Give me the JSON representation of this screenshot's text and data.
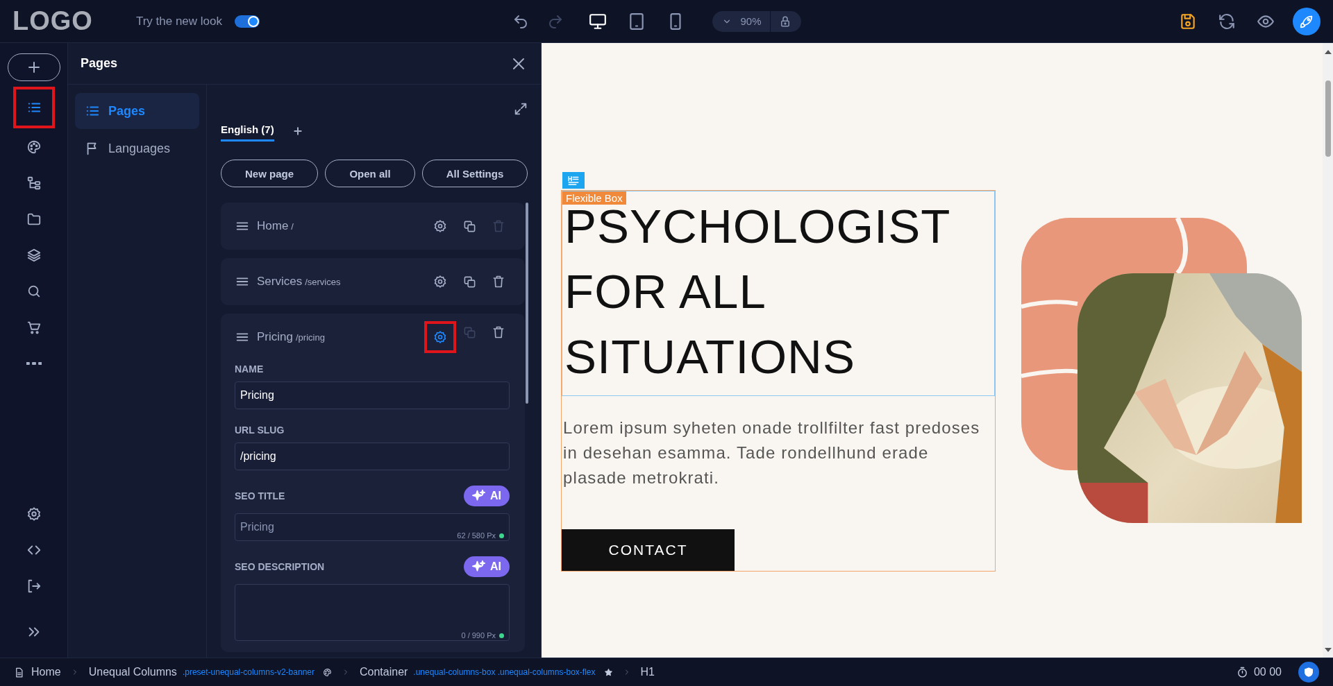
{
  "topbar": {
    "logo": "LOGO",
    "new_look": {
      "label": "Try the new look",
      "on": true
    },
    "history": [
      {
        "kind": "undo",
        "disabled": false
      },
      {
        "kind": "redo",
        "disabled": true
      }
    ],
    "devices": [
      {
        "kind": "desktop",
        "selected": true
      },
      {
        "kind": "tablet",
        "selected": false
      },
      {
        "kind": "phone",
        "selected": false
      }
    ],
    "zoom": "90%"
  },
  "rail": {
    "items": [
      {
        "kind": "add",
        "selected": false,
        "highlighted": false
      },
      {
        "kind": "list",
        "selected": true,
        "highlighted": true
      },
      {
        "kind": "palette",
        "selected": false,
        "highlighted": false
      },
      {
        "kind": "tree",
        "selected": false,
        "highlighted": false
      },
      {
        "kind": "folder",
        "selected": false,
        "highlighted": false
      },
      {
        "kind": "layers",
        "selected": false,
        "highlighted": false
      },
      {
        "kind": "search",
        "selected": false,
        "highlighted": false
      },
      {
        "kind": "cart",
        "selected": false,
        "highlighted": false
      },
      {
        "kind": "more",
        "selected": false,
        "highlighted": false
      }
    ],
    "bottom_items": [
      {
        "kind": "settings"
      },
      {
        "kind": "code"
      },
      {
        "kind": "exit"
      },
      {
        "kind": "expand"
      }
    ]
  },
  "panel": {
    "title": "Pages",
    "nav": [
      {
        "label": "Pages",
        "kind": "list",
        "selected": true
      },
      {
        "label": "Languages",
        "kind": "flag",
        "selected": false
      }
    ],
    "tabs": [
      {
        "label": "English (7)",
        "selected": true
      }
    ],
    "buttons": [
      "New page",
      "Open all",
      "All Settings"
    ],
    "pages": [
      {
        "name": "Home",
        "slug": "/",
        "expanded": false,
        "settings_active": false,
        "highlighted": false,
        "duplicate_disabled": false,
        "delete_disabled": true
      },
      {
        "name": "Services",
        "slug": "/services",
        "expanded": false,
        "settings_active": false,
        "highlighted": false,
        "duplicate_disabled": false,
        "delete_disabled": false
      },
      {
        "name": "Pricing",
        "slug": "/pricing",
        "expanded": true,
        "settings_active": true,
        "highlighted": true,
        "duplicate_disabled": true,
        "delete_disabled": false,
        "fields": [
          {
            "kind": "input",
            "label": "NAME",
            "value": "Pricing"
          },
          {
            "kind": "input",
            "label": "URL SLUG",
            "value": "/pricing"
          },
          {
            "kind": "input",
            "label": "SEO TITLE",
            "ai": "AI",
            "placeholder": "Pricing",
            "counter": "62 / 580 Px"
          },
          {
            "kind": "textarea",
            "label": "SEO DESCRIPTION",
            "ai": "AI",
            "counter": "0 / 990 Px"
          }
        ]
      }
    ]
  },
  "canvas": {
    "element_label": "Flexible Box",
    "heading": "PSYCHOLOGIST FOR ALL SITUATIONS",
    "text": "Lorem ipsum syheten onade trollfilter fast predoses in desehan esamma. Tade rondellhund erade plasade metrokrati.",
    "button": "CONTACT"
  },
  "status_bar": {
    "crumbs": [
      {
        "label": "Home",
        "kind": "page"
      },
      {
        "label": "Unequal Columns",
        "classes": ".preset-unequal-columns-v2-banner",
        "kind": "palette"
      },
      {
        "label": "Container",
        "classes": ".unequal-columns-box .unequal-columns-box-flex",
        "kind": "star"
      },
      {
        "label": "H1",
        "kind": "plain"
      }
    ],
    "timer": "00 00"
  }
}
